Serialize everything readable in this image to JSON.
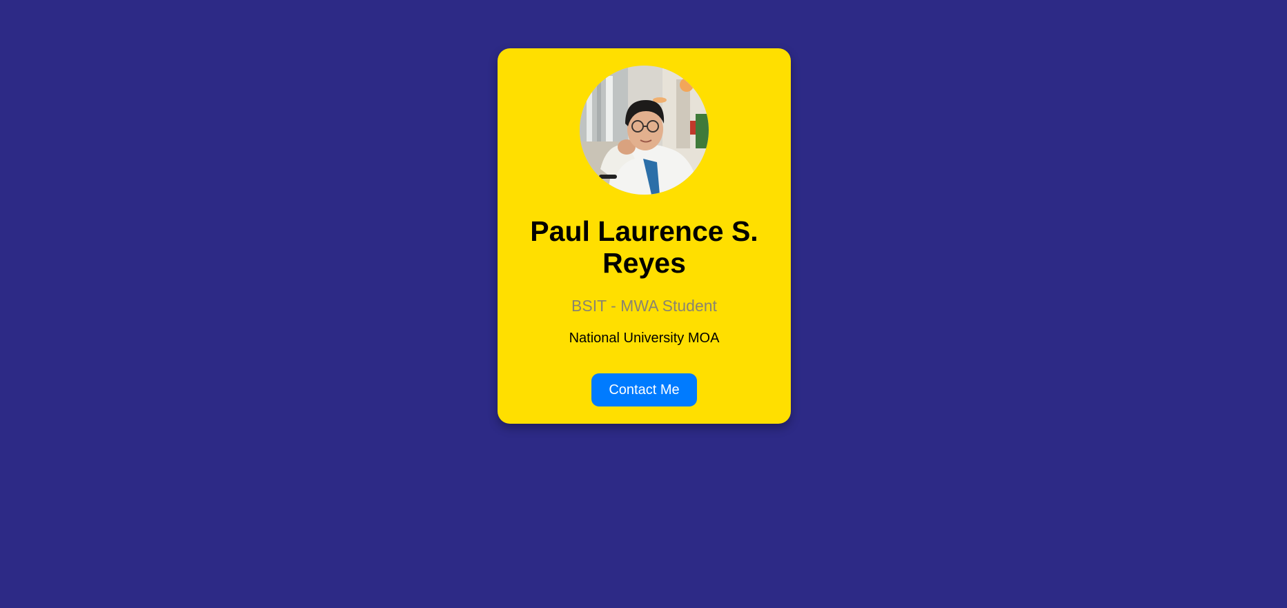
{
  "profile": {
    "name": "Paul Laurence S. Reyes",
    "role": "BSIT - MWA Student",
    "school": "National University MOA",
    "contact_label": "Contact Me"
  },
  "theme": {
    "background": "#2d2a86",
    "card": "#ffdf00",
    "button": "#007bff",
    "button_text": "#ffffff"
  },
  "avatar": {
    "icon": "profile-photo"
  }
}
